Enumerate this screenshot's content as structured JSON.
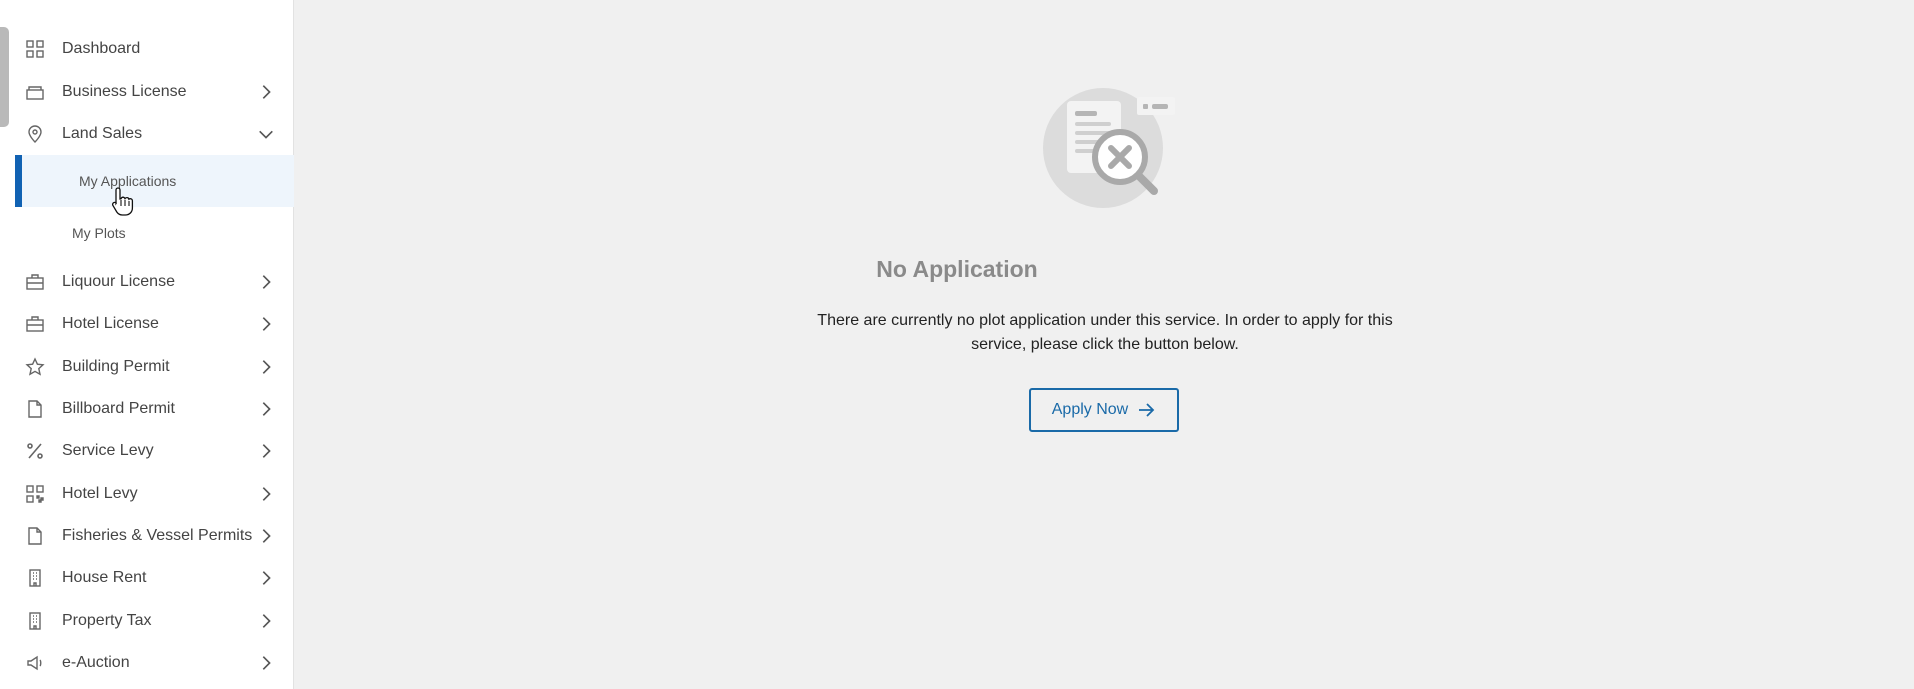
{
  "sidebar": {
    "items": [
      {
        "label": "Dashboard",
        "icon": "dashboard-grid-icon"
      },
      {
        "label": "Business License",
        "icon": "briefcase-stack-icon"
      },
      {
        "label": "Land Sales",
        "icon": "map-pin-icon"
      },
      {
        "label": "Liquour License",
        "icon": "briefcase-icon"
      },
      {
        "label": "Hotel License",
        "icon": "briefcase-icon"
      },
      {
        "label": "Building Permit",
        "icon": "star-icon"
      },
      {
        "label": "Billboard Permit",
        "icon": "document-icon"
      },
      {
        "label": "Service Levy",
        "icon": "percent-icon"
      },
      {
        "label": "Hotel Levy",
        "icon": "qr-code-icon"
      },
      {
        "label": "Fisheries & Vessel Permits",
        "icon": "document-icon"
      },
      {
        "label": "House Rent",
        "icon": "building-icon"
      },
      {
        "label": "Property Tax",
        "icon": "building-icon"
      },
      {
        "label": "e-Auction",
        "icon": "megaphone-icon"
      }
    ],
    "land_sales_sub": [
      {
        "label": "My Applications",
        "active": true
      },
      {
        "label": "My Plots",
        "active": false
      }
    ]
  },
  "main": {
    "empty_title": "No Application",
    "empty_description": "There are currently no plot application under this service. In order to apply for this service, please click the button below.",
    "apply_button": "Apply Now"
  },
  "colors": {
    "accent": "#1162b3",
    "button": "#1a6aa8",
    "background": "#f0f0f0",
    "active_sub_bg": "#eef5fc"
  }
}
